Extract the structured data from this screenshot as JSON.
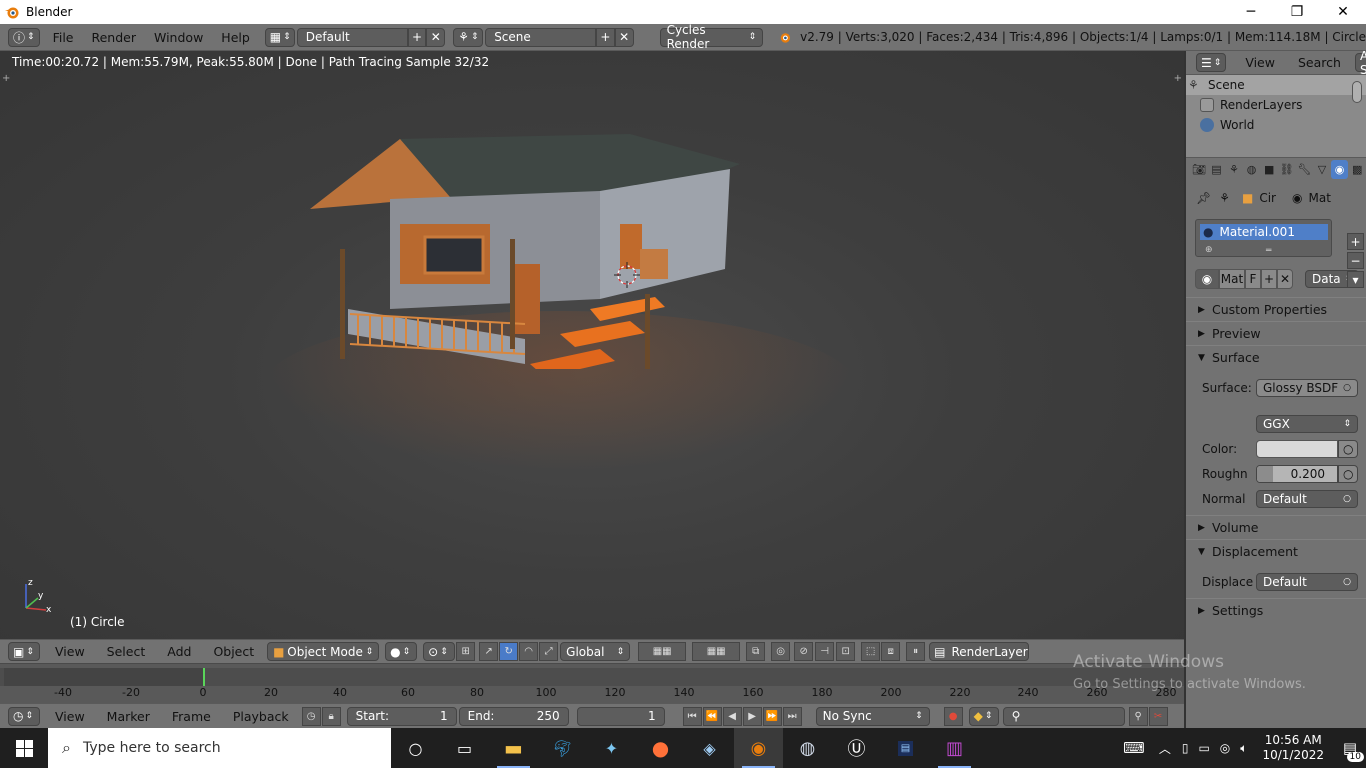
{
  "window": {
    "title": "Blender",
    "controls": {
      "minimize": "─",
      "maximize": "❐",
      "close": "✕"
    }
  },
  "header": {
    "menus": [
      "File",
      "Render",
      "Window",
      "Help"
    ],
    "layout_name": "Default",
    "scene_name": "Scene",
    "engine": "Cycles Render",
    "stats": "v2.79 | Verts:3,020 | Faces:2,434 | Tris:4,896 | Objects:1/4 | Lamps:0/1 | Mem:114.18M | Circle"
  },
  "viewport": {
    "render_info": "Time:00:20.72 | Mem:55.79M, Peak:55.80M | Done | Path Tracing Sample 32/32",
    "object_label": "(1) Circle",
    "axis_x": "x",
    "axis_y": "y",
    "axis_z": "z"
  },
  "viewport_header": {
    "menus": [
      "View",
      "Select",
      "Add",
      "Object"
    ],
    "mode": "Object Mode",
    "orientation": "Global",
    "render_layer": "RenderLayer"
  },
  "timeline": {
    "ruler": [
      "-40",
      "-20",
      "0",
      "20",
      "40",
      "60",
      "80",
      "100",
      "120",
      "140",
      "160",
      "180",
      "200",
      "220",
      "240",
      "260",
      "280"
    ],
    "current_frame_marker": 0
  },
  "timeline_header": {
    "menus": [
      "View",
      "Marker",
      "Frame",
      "Playback"
    ],
    "start_label": "Start:",
    "start_value": "1",
    "end_label": "End:",
    "end_value": "250",
    "current_frame": "1",
    "sync": "No Sync"
  },
  "outliner": {
    "menus": [
      "View",
      "Search"
    ],
    "filter": "All Sc",
    "items": [
      "Scene",
      "RenderLayers",
      "World"
    ]
  },
  "properties": {
    "context": {
      "object": "Cir",
      "material": "Mat"
    },
    "material_slot": "Material.001",
    "material_field": "Mat",
    "fake_user": "F",
    "link": "Data",
    "panels": {
      "custom_properties": "Custom Properties",
      "preview": "Preview",
      "surface": "Surface",
      "volume": "Volume",
      "displacement": "Displacement",
      "settings": "Settings"
    },
    "surface": {
      "surface_label": "Surface:",
      "surface_value": "Glossy BSDF",
      "distribution": "GGX",
      "color_label": "Color:",
      "roughness_label": "Roughn",
      "roughness_value": "0.200",
      "normal_label": "Normal",
      "normal_value": "Default"
    },
    "displacement": {
      "label": "Displace",
      "value": "Default"
    }
  },
  "watermark": {
    "line1": "Activate Windows",
    "line2": "Go to Settings to activate Windows."
  },
  "taskbar": {
    "search_placeholder": "Type here to search",
    "time": "10:56 AM",
    "date": "10/1/2022",
    "notification_count": "10",
    "apps": [
      "cortana-icon",
      "task-view-icon",
      "file-explorer-icon",
      "dolphin-icon",
      "puzzle-icon",
      "firefox-icon",
      "network-icon",
      "blender-icon",
      "obs-icon",
      "unreal-icon",
      "epic-icon",
      "winrar-icon"
    ]
  },
  "colors": {
    "accent_blue": "#4f7fc8",
    "panel_gray": "#727272",
    "viewport_bg": "#3e3e3e",
    "taskbar_bg": "#1f1f1f"
  }
}
